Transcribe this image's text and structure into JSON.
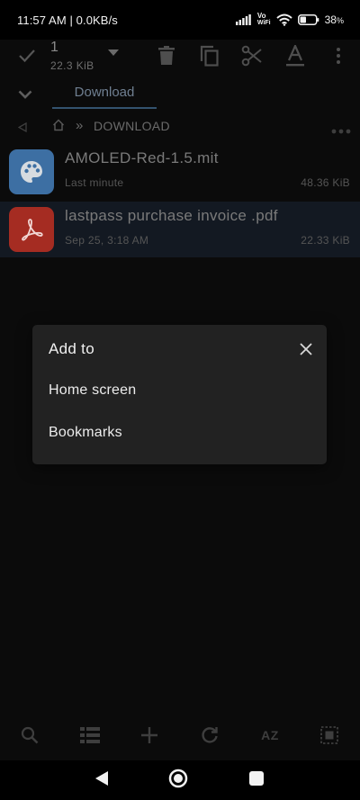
{
  "status_bar": {
    "time_and_speed": "11:57 AM | 0.0KB/s",
    "volte_label_top": "Vo",
    "volte_label_bottom": "WiFi",
    "battery_percent": "38",
    "battery_suffix": "%"
  },
  "toolbar": {
    "selected_count": "1",
    "selected_size": "22.3 KiB",
    "icons": [
      "check-icon",
      "dropdown-arrow-icon",
      "delete-icon",
      "copy-icon",
      "cut-icon",
      "rename-icon",
      "more-vert-icon"
    ]
  },
  "tabs": {
    "active_label": "Download"
  },
  "breadcrumb": {
    "separator": "»",
    "current": "DOWNLOAD"
  },
  "files": [
    {
      "name": "AMOLED-Red-1.5.mit",
      "date": "Last minute",
      "size": "48.36 KiB",
      "icon": "palette-icon",
      "icon_bg": "#3d6fa3",
      "selected": false
    },
    {
      "name": "lastpass purchase invoice .pdf",
      "date": "Sep 25, 3:18 AM",
      "size": "22.33 KiB",
      "icon": "pdf-icon",
      "icon_bg": "#a52c22",
      "selected": true
    }
  ],
  "bottom_bar": {
    "sort_label": "AZ",
    "icons": [
      "search-icon",
      "view-list-icon",
      "add-icon",
      "refresh-icon",
      "sort-icon",
      "select-all-icon"
    ]
  },
  "dialog": {
    "title": "Add to",
    "options": [
      "Home screen",
      "Bookmarks"
    ]
  },
  "colors": {
    "dialog_bg": "#222222",
    "accent": "#34536f",
    "background": "#0b0b0b"
  }
}
